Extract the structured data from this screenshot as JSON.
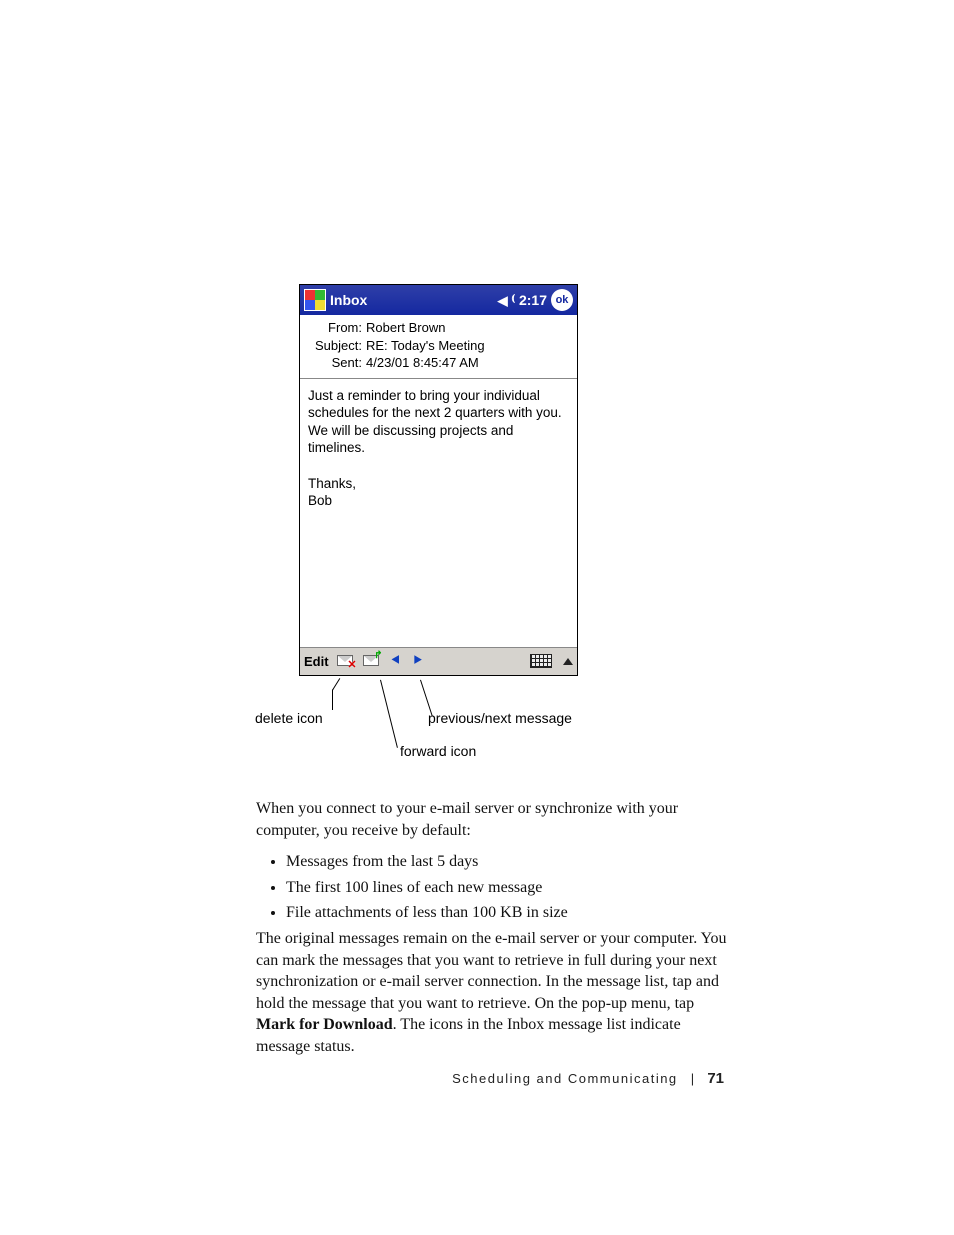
{
  "titlebar": {
    "appname": "Inbox",
    "time": "2:17",
    "ok": "ok"
  },
  "header": {
    "from_label": "From:",
    "from": "Robert Brown",
    "subject_label": "Subject:",
    "subject": "RE: Today's Meeting",
    "sent_label": "Sent:",
    "sent": "4/23/01 8:45:47 AM"
  },
  "body": {
    "p1": "Just a reminder to bring your individual schedules for the next 2 quarters with you. We will be discussing projects and timelines.",
    "p2": "Thanks,",
    "p3": "Bob"
  },
  "menubar": {
    "edit": "Edit"
  },
  "callouts": {
    "delete": "delete icon",
    "prevnext": "previous/next message",
    "forward": "forward icon"
  },
  "para1": "When you connect to your e-mail server or synchronize with your computer, you receive by default:",
  "bullets": [
    "Messages from the last 5 days",
    "The first 100 lines of each new message",
    "File attachments of less than 100 KB in size"
  ],
  "para2a": "The original messages remain on the e-mail server or your computer. You can mark the messages that you want to retrieve in full during your next synchronization or e-mail server connection. In the message list, tap and hold the message that you want to retrieve. On the pop-up menu, tap ",
  "para2bold": "Mark for Download",
  "para2b": ". The icons in the Inbox message list indicate message status.",
  "footer": {
    "section": "Scheduling and Communicating",
    "page": "71"
  }
}
